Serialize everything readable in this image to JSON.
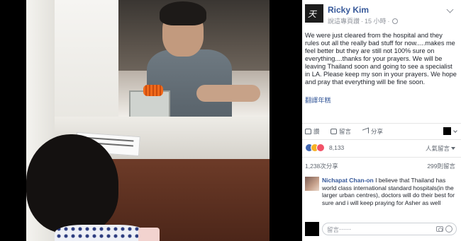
{
  "post": {
    "author": "Ricky Kim",
    "author_avatar_text": "天",
    "meta_prefix": "說這專頁讚",
    "timestamp": "15 小時",
    "text": "We were just cleared from the hospital and they rules out all the really bad stuff for now.....makes me feel better but they are still not 100% sure on everything....thanks for your prayers. We will be leaving Thailand soon and going to see a specialist in LA. Please keep my son in your prayers. We hope and pray that everything will be fine soon.",
    "translate_link": "翻譯年糕"
  },
  "actions": {
    "like": "讚",
    "comment": "留言",
    "share": "分享"
  },
  "stats": {
    "reaction_count": "8,133",
    "sort_label": "人氣留言",
    "shares": "1,238次分享",
    "comments": "299則留言"
  },
  "comment": {
    "author": "Nichapat Chan-on",
    "text": "I believe that Thailand has world class international standard hospitals(in the larger urban centres), doctors will do their best for sure and i will keep praying for Asher as well"
  },
  "composer": {
    "placeholder": "留言⋯⋯"
  },
  "icons": {
    "like": "thumbs-up-icon",
    "comment": "comment-icon",
    "share": "share-icon",
    "camera": "camera-icon",
    "emoji": "smiley-icon",
    "globe": "globe-icon"
  },
  "colors": {
    "link": "#365899",
    "text": "#1d2129",
    "muted": "#606770",
    "like": "#4267b2",
    "wow": "#f7b125",
    "love": "#f25268"
  }
}
